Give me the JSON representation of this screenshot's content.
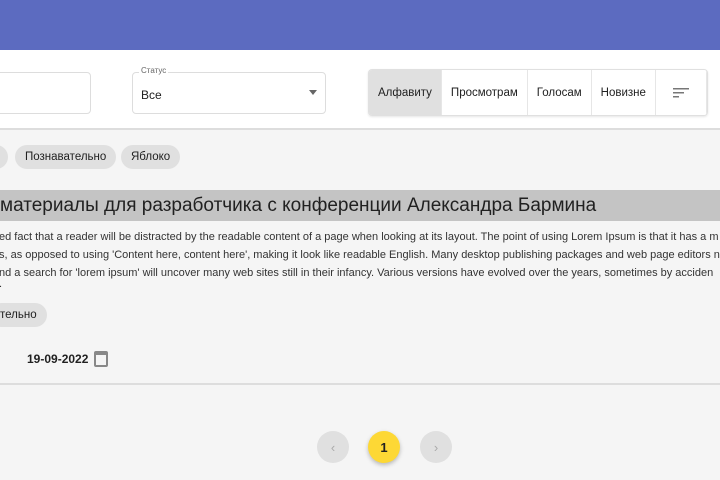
{
  "filters": {
    "status_label": "Статус",
    "status_value": "Все"
  },
  "sort": {
    "options": [
      "Алфавиту",
      "Просмотрам",
      "Голосам",
      "Новизне"
    ],
    "active": "Алфавиту"
  },
  "tags": [
    "Познавательно",
    "Яблоко"
  ],
  "article": {
    "title": "материалы для разработчика с конференции Александра Бармина",
    "lines": [
      "ed fact that a reader will be distracted by the readable content of a page when looking at its layout. The point of using Lorem Ipsum is that it has a m",
      "s, as opposed to using 'Content here, content here', making it look like readable English. Many desktop publishing packages and web page editors n",
      "nd a search for 'lorem ipsum' will uncover many web sites still in their infancy. Various versions have evolved over the years, sometimes by acciden",
      "."
    ],
    "tag": "тельно",
    "date": "19-09-2022"
  },
  "pagination": {
    "current": "1",
    "prev": "‹",
    "next": "›"
  },
  "colors": {
    "header": "#5c6bc0",
    "active_page": "#fdd835"
  }
}
